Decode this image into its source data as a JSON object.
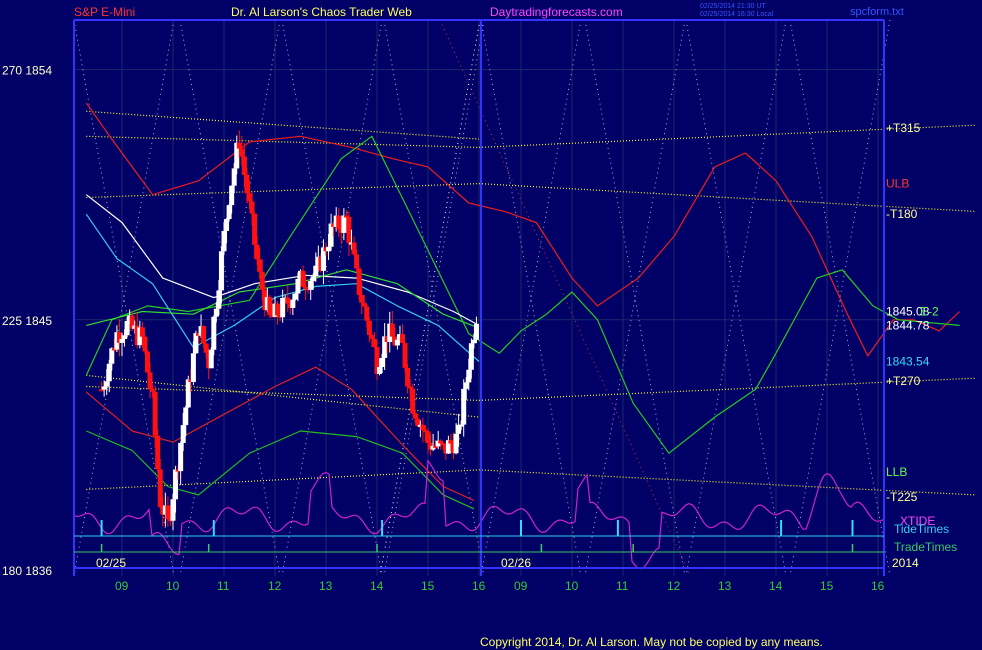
{
  "header": {
    "instrument": "S&P E-Mini",
    "site_title": "Dr. Al Larson's Chaos Trader Web",
    "site_url": "Daytradingforecasts.com",
    "stamp_line1": "02/25/2014 21:30 UT",
    "stamp_line2": "02/25/2014 16:30 Local",
    "file_name": "spcform.txt"
  },
  "footer": {
    "copyright": "Copyright 2014, Dr. Al Larson. May not be copied by any means."
  },
  "y_axis_labels": [
    {
      "text": "270  1854",
      "price": 1854
    },
    {
      "text": "225  1845",
      "price": 1845
    },
    {
      "text": "180  1836",
      "price": 1836
    }
  ],
  "right_labels": [
    {
      "text": "+T315",
      "price": 1851.9,
      "color": "#ffff99"
    },
    {
      "text": "ULB",
      "price": 1849.9,
      "color": "#ff3333"
    },
    {
      "text": "-T180",
      "price": 1848.8,
      "color": "#ffff99"
    },
    {
      "text": "1845.08",
      "price": 1845.3,
      "color": "#ffffff"
    },
    {
      "text": "E-2",
      "price": 1845.3,
      "color": "#55ff55"
    },
    {
      "text": "1844.78",
      "price": 1844.8,
      "color": "#ffffff"
    },
    {
      "text": "1843.54",
      "price": 1843.5,
      "color": "#33ddff"
    },
    {
      "text": "+T270",
      "price": 1842.8,
      "color": "#ffff99"
    },
    {
      "text": "LLB",
      "price": 1839.7,
      "color": "#55ff55"
    },
    {
      "text": "-T225",
      "price": 1838.6,
      "color": "#ffff99"
    },
    {
      "text": "XTIDE",
      "price": 1837.9,
      "color": "#ff44ff"
    }
  ],
  "lower_labels": {
    "tide_times": "TideTimes",
    "trade_times": "TradeTimes",
    "year": "2014"
  },
  "chart_data": {
    "type": "candlestick",
    "title": "S&P E-Mini",
    "ylim": [
      1836,
      1855
    ],
    "days": [
      {
        "date": "02/25",
        "hours": [
          "09",
          "10",
          "11",
          "12",
          "13",
          "14",
          "15",
          "16"
        ]
      },
      {
        "date": "02/26",
        "hours": [
          "09",
          "10",
          "11",
          "12",
          "13",
          "14",
          "15",
          "16"
        ]
      }
    ],
    "price_path": [
      {
        "t": 8.6,
        "p": 1842.5
      },
      {
        "t": 8.9,
        "p": 1844.5
      },
      {
        "t": 9.1,
        "p": 1844.8
      },
      {
        "t": 9.4,
        "p": 1844.3
      },
      {
        "t": 9.6,
        "p": 1842
      },
      {
        "t": 9.75,
        "p": 1838.5
      },
      {
        "t": 9.9,
        "p": 1837.6
      },
      {
        "t": 10.1,
        "p": 1840
      },
      {
        "t": 10.3,
        "p": 1842.5
      },
      {
        "t": 10.5,
        "p": 1844.8
      },
      {
        "t": 10.7,
        "p": 1843.5
      },
      {
        "t": 10.9,
        "p": 1846.5
      },
      {
        "t": 11.1,
        "p": 1849.5
      },
      {
        "t": 11.3,
        "p": 1851.5
      },
      {
        "t": 11.5,
        "p": 1849
      },
      {
        "t": 11.7,
        "p": 1846.5
      },
      {
        "t": 11.9,
        "p": 1845
      },
      {
        "t": 12.2,
        "p": 1845.5
      },
      {
        "t": 12.5,
        "p": 1846.4
      },
      {
        "t": 12.8,
        "p": 1846.6
      },
      {
        "t": 13.1,
        "p": 1848.2
      },
      {
        "t": 13.4,
        "p": 1848.6
      },
      {
        "t": 13.6,
        "p": 1846.5
      },
      {
        "t": 13.8,
        "p": 1845
      },
      {
        "t": 14.0,
        "p": 1843.5
      },
      {
        "t": 14.2,
        "p": 1844.5
      },
      {
        "t": 14.5,
        "p": 1844
      },
      {
        "t": 14.7,
        "p": 1842
      },
      {
        "t": 15.0,
        "p": 1840.6
      },
      {
        "t": 15.3,
        "p": 1840.3
      },
      {
        "t": 15.6,
        "p": 1840.8
      },
      {
        "t": 15.8,
        "p": 1843.5
      },
      {
        "t": 16.0,
        "p": 1845.8
      }
    ],
    "lines": [
      {
        "name": "ULB",
        "color": "#ee1c1c",
        "points": [
          [
            8.3,
            1852.8
          ],
          [
            8.8,
            1851.5
          ],
          [
            9.6,
            1849.5
          ],
          [
            10.5,
            1850
          ],
          [
            11.5,
            1851.4
          ],
          [
            12.5,
            1851.6
          ],
          [
            13.5,
            1851.2
          ],
          [
            14.3,
            1850.8
          ],
          [
            15.0,
            1850.5
          ],
          [
            15.8,
            1849.2
          ],
          [
            16.5,
            1848.9
          ],
          [
            17.3,
            1848.5
          ],
          [
            18.0,
            1846.5
          ],
          [
            18.5,
            1845.5
          ],
          [
            19.3,
            1846.5
          ],
          [
            20.0,
            1848
          ],
          [
            20.8,
            1850.5
          ],
          [
            21.4,
            1851
          ],
          [
            22.0,
            1850
          ],
          [
            22.7,
            1848
          ],
          [
            23.4,
            1845.2
          ],
          [
            23.8,
            1843.7
          ],
          [
            24.3,
            1845
          ],
          [
            24.7,
            1845
          ],
          [
            25.2,
            1844.6
          ],
          [
            25.6,
            1845.3
          ]
        ]
      },
      {
        "name": "LLB",
        "color": "#22cc22",
        "points": [
          [
            8.3,
            1843
          ],
          [
            8.8,
            1845
          ],
          [
            9.5,
            1845.5
          ],
          [
            10.3,
            1845.3
          ],
          [
            11.5,
            1845.7
          ],
          [
            12.3,
            1848
          ],
          [
            13.3,
            1850.8
          ],
          [
            13.9,
            1851.6
          ],
          [
            14.6,
            1849
          ],
          [
            15.4,
            1846
          ],
          [
            15.8,
            1844.5
          ],
          [
            16.4,
            1843.8
          ],
          [
            17.0,
            1844.6
          ],
          [
            17.5,
            1845.2
          ],
          [
            18.0,
            1846
          ],
          [
            18.5,
            1845
          ],
          [
            19.2,
            1842
          ],
          [
            19.9,
            1840.2
          ],
          [
            20.8,
            1841.5
          ],
          [
            21.6,
            1842.5
          ],
          [
            22.0,
            1843.8
          ],
          [
            22.8,
            1846.5
          ],
          [
            23.3,
            1846.8
          ],
          [
            23.9,
            1845.5
          ],
          [
            24.4,
            1845
          ],
          [
            25.6,
            1844.8
          ]
        ]
      },
      {
        "name": "ULB2",
        "color": "#dd2222",
        "points": [
          [
            8.3,
            1842.4
          ],
          [
            9.2,
            1841
          ],
          [
            10.0,
            1840.6
          ],
          [
            11.0,
            1841.6
          ],
          [
            12.0,
            1842.6
          ],
          [
            12.8,
            1843.3
          ],
          [
            13.5,
            1842.5
          ],
          [
            14.5,
            1840.5
          ],
          [
            15.3,
            1839
          ],
          [
            15.9,
            1838.5
          ]
        ]
      },
      {
        "name": "LLB2",
        "color": "#22bb22",
        "points": [
          [
            8.3,
            1841
          ],
          [
            9.2,
            1840.3
          ],
          [
            9.9,
            1839
          ],
          [
            10.5,
            1838.7
          ],
          [
            11.5,
            1840.2
          ],
          [
            12.5,
            1841
          ],
          [
            13.6,
            1840.8
          ],
          [
            14.5,
            1840.2
          ],
          [
            15.3,
            1838.7
          ],
          [
            15.9,
            1838.2
          ]
        ]
      },
      {
        "name": "MA-white",
        "color": "#ffffff",
        "points": [
          [
            8.3,
            1849.5
          ],
          [
            9.0,
            1848.5
          ],
          [
            9.8,
            1846.5
          ],
          [
            10.8,
            1845.8
          ],
          [
            11.6,
            1846.3
          ],
          [
            12.6,
            1846.6
          ],
          [
            13.6,
            1846.5
          ],
          [
            14.6,
            1846
          ],
          [
            15.5,
            1845.3
          ],
          [
            16.0,
            1844.8
          ]
        ]
      },
      {
        "name": "MA-cyan",
        "color": "#33ccee",
        "points": [
          [
            8.3,
            1848.8
          ],
          [
            8.9,
            1847.2
          ],
          [
            9.6,
            1846.3
          ],
          [
            10.4,
            1844
          ],
          [
            11.2,
            1844.8
          ],
          [
            12.0,
            1845.8
          ],
          [
            12.8,
            1846.2
          ],
          [
            13.6,
            1846.3
          ],
          [
            14.4,
            1845.5
          ],
          [
            15.2,
            1844.8
          ],
          [
            16.0,
            1843.5
          ]
        ]
      },
      {
        "name": "MA-green",
        "color": "#33dd33",
        "points": [
          [
            8.3,
            1844.8
          ],
          [
            9.4,
            1845.3
          ],
          [
            10.4,
            1845.2
          ],
          [
            11.3,
            1846
          ],
          [
            12.4,
            1846.3
          ],
          [
            13.4,
            1846.8
          ],
          [
            14.4,
            1846.3
          ],
          [
            15.3,
            1845.2
          ],
          [
            16.0,
            1844.7
          ]
        ]
      }
    ],
    "time_lines": [
      {
        "name": "+T315",
        "points": [
          [
            8.3,
            1851.6
          ],
          [
            16.0,
            1851.2
          ],
          [
            25.9,
            1852
          ]
        ]
      },
      {
        "name": "-T180",
        "points": [
          [
            8.3,
            1849.4
          ],
          [
            16.0,
            1849.9
          ],
          [
            25.9,
            1848.9
          ]
        ]
      },
      {
        "name": "+T270",
        "points": [
          [
            8.3,
            1842.6
          ],
          [
            16.0,
            1842.1
          ],
          [
            25.9,
            1842.9
          ]
        ]
      },
      {
        "name": "-T225",
        "points": [
          [
            8.3,
            1838.9
          ],
          [
            16.0,
            1839.6
          ],
          [
            25.9,
            1838.7
          ]
        ]
      },
      {
        "name": "upper",
        "points": [
          [
            8.3,
            1852.5
          ],
          [
            16.0,
            1851.5
          ]
        ]
      },
      {
        "name": "mid",
        "points": [
          [
            8.3,
            1843
          ],
          [
            16.0,
            1841.5
          ]
        ]
      }
    ],
    "tide_markers": [
      8.6,
      10.8,
      14.1,
      17.0,
      18.9,
      22.1,
      23.5
    ],
    "trade_markers": [
      8.6,
      10.7,
      14.0,
      17.4,
      19.2,
      23.5
    ]
  }
}
